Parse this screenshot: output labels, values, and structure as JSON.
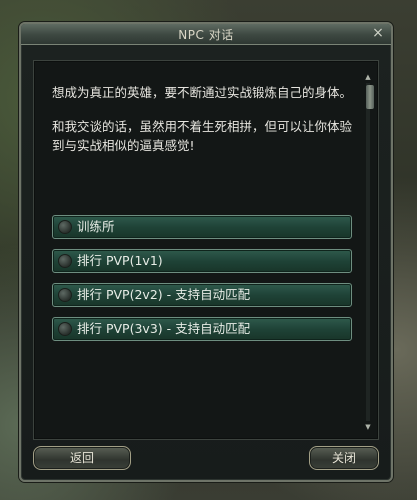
{
  "window": {
    "title": "NPC 对话",
    "close_glyph": "×"
  },
  "dialog": {
    "paragraphs": [
      "想成为真正的英雄，要不断通过实战锻炼自己的身体。",
      "和我交谈的话，虽然用不着生死相拼，但可以让你体验到与实战相似的逼真感觉!"
    ]
  },
  "options": [
    {
      "label": "训练所",
      "icon": "option-bullet-icon"
    },
    {
      "label": "排行 PVP(1v1)",
      "icon": "option-bullet-icon"
    },
    {
      "label": "排行 PVP(2v2) - 支持自动匹配",
      "icon": "option-bullet-icon"
    },
    {
      "label": "排行 PVP(3v3) - 支持自动匹配",
      "icon": "option-bullet-icon"
    }
  ],
  "buttons": {
    "back": "返回",
    "close": "关闭"
  }
}
